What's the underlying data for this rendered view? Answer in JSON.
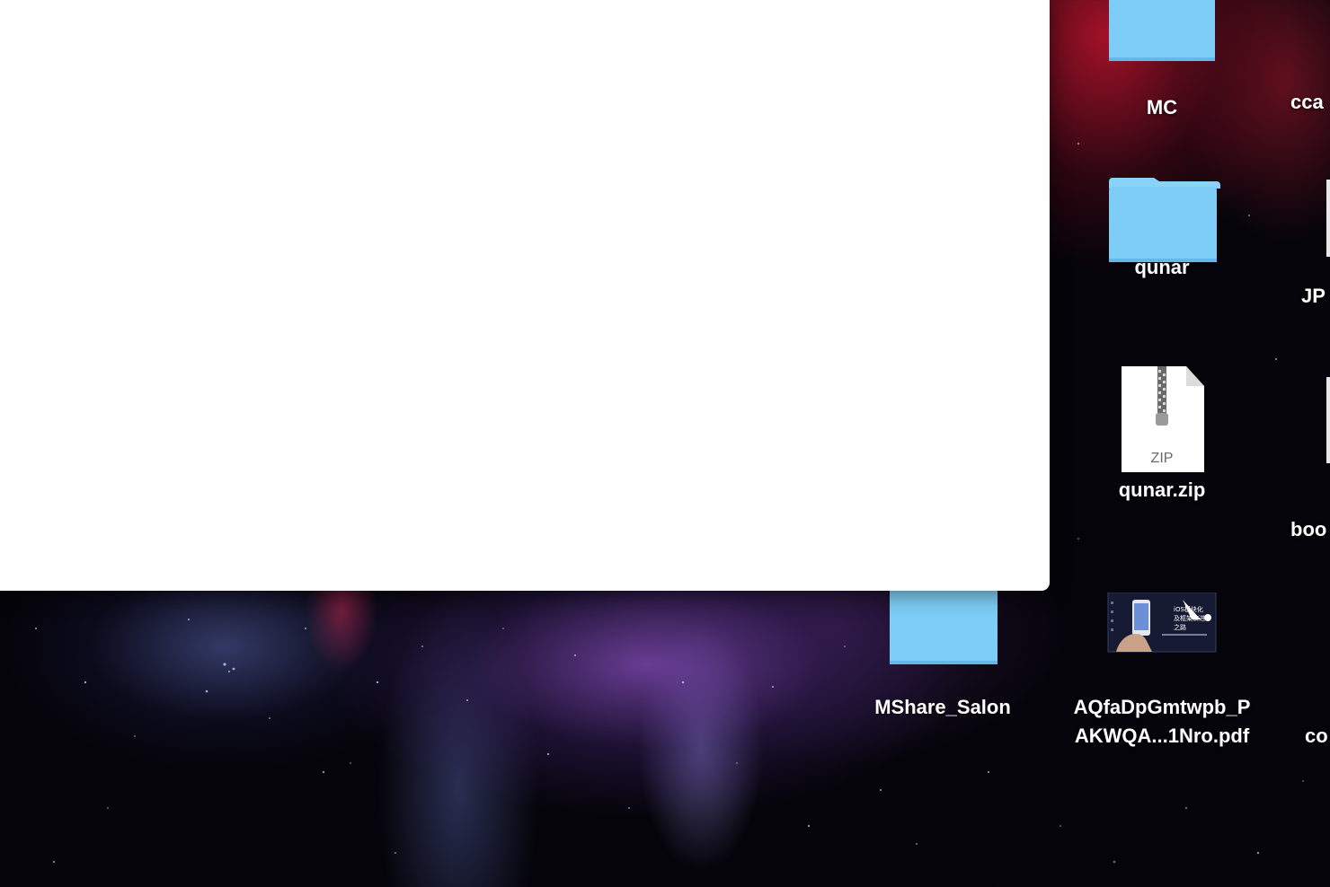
{
  "desktop": {
    "items": [
      {
        "label": "MC",
        "icon": "folder-icon"
      },
      {
        "label": "cca",
        "icon": "folder-icon"
      },
      {
        "label": "qunar",
        "icon": "folder-icon"
      },
      {
        "label": "JP",
        "icon": "document-icon"
      },
      {
        "label": "qunar.zip",
        "icon": "zip-archive-icon",
        "icon_text": "ZIP"
      },
      {
        "label": "boo",
        "icon": "document-icon"
      },
      {
        "label": "MShare_Salon",
        "icon": "folder-icon"
      },
      {
        "label": "AQfaDpGmtwpb_PAKWQA...1Nro.pdf",
        "label_line1": "AQfaDpGmtwpb_P",
        "label_line2": "AKWQA...1Nro.pdf",
        "icon": "pdf-thumbnail-icon",
        "thumbnail_text": "iOS模块化及框架演进之路"
      },
      {
        "label": "co",
        "icon": "document-icon"
      }
    ]
  },
  "colors": {
    "folder": "#7dcdf6",
    "folder_tab": "#8ad3f8",
    "window": "#fefefe",
    "label": "#ffffff"
  }
}
